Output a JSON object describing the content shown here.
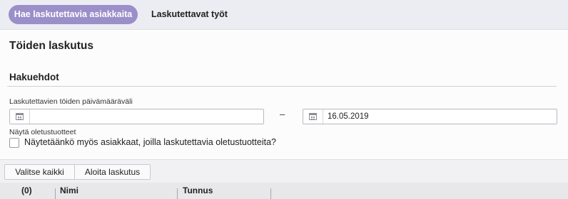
{
  "nav": {
    "active_tab": "Hae laskutettavia asiakkaita",
    "second_tab": "Laskutettavat työt"
  },
  "page": {
    "title": "Töiden laskutus",
    "section_title": "Hakuehdot"
  },
  "date_range": {
    "label": "Laskutettavien töiden päivämääräväli",
    "start_value": "",
    "separator": "–",
    "end_value": "16.05.2019"
  },
  "default_products": {
    "label": "Näytä oletustuotteet",
    "checkbox_label": "Näytetäänkö myös asiakkaat, joilla laskutettavia oletustuotteita?",
    "checked": false
  },
  "toolbar": {
    "select_all_label": "Valitse kaikki",
    "start_billing_label": "Aloita laskutus"
  },
  "table": {
    "columns": [
      "(0)",
      "Nimi",
      "Tunnus"
    ]
  }
}
